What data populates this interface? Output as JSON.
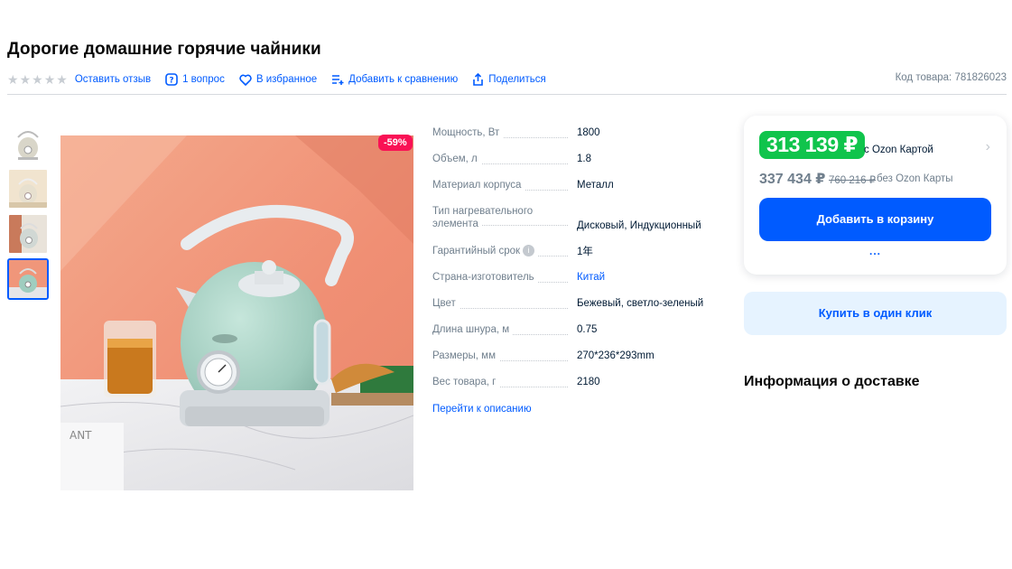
{
  "product": {
    "title": "Дорогие домашние горячие чайники",
    "sku_label": "Код товара:",
    "sku_value": "781826023"
  },
  "actions": {
    "rating_stars": 5,
    "review": "Оставить отзыв",
    "question": "1 вопрос",
    "favorite": "В избранное",
    "compare": "Добавить к сравнению",
    "share": "Поделиться"
  },
  "gallery": {
    "discount_badge": "-59%",
    "thumbnail_count": 4,
    "active_thumbnail": 4
  },
  "specs": [
    {
      "key": "Мощность, Вт",
      "value": "1800"
    },
    {
      "key": "Объем, л",
      "value": "1.8"
    },
    {
      "key": "Материал корпуса",
      "value": "Металл"
    },
    {
      "key": "Тип нагревательного элемента",
      "value": "Дисковый, Индукционный"
    },
    {
      "key": "Гарантийный срок",
      "value": "1年"
    },
    {
      "key": "Страна-изготовитель",
      "value": "Китай"
    },
    {
      "key": "Цвет",
      "value": "Бежевый, светло-зеленый"
    },
    {
      "key": "Длина шнура, м",
      "value": "0.75"
    },
    {
      "key": "Размеры, мм",
      "value": "270*236*293mm"
    },
    {
      "key": "Вес товара, г",
      "value": "2180"
    }
  ],
  "goto_description": "Перейти к описанию",
  "price": {
    "card_price": "313 139 ₽",
    "card_label": "с Ozon Картой",
    "regular_price": "337 434 ₽",
    "old_price": "760 216 ₽",
    "no_card_label": "без Ozon Карты",
    "add_to_cart": "Добавить в корзину",
    "more": "...",
    "buy_one_click": "Купить в один клик"
  },
  "delivery": {
    "title": "Информация о доставке"
  },
  "colors": {
    "accent": "#005bff",
    "price_green": "#10c44c",
    "discount_pink": "#f91155"
  }
}
